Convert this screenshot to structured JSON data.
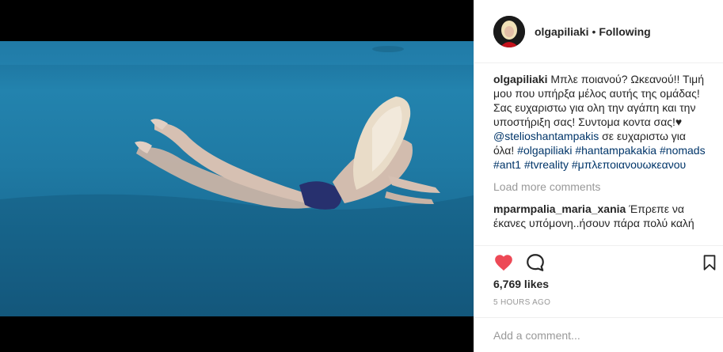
{
  "post": {
    "username": "olgapiliaki",
    "separator": "•",
    "follow_status": "Following"
  },
  "caption": {
    "username": "olgapiliaki",
    "text_part1": " Μπλε ποιανού? Ωκεανού!! Τιμή μου που υπήρξα μέλος αυτής της ομάδας! Σας ευχαριστω για ολη την αγάπη και την υποστήριξη σας! Συντομα κοντα σας!♥ ",
    "mention": "@stelioshantampakis",
    "text_part2": " σε ευχαριστω για όλα! ",
    "hashtags": [
      "#olgapiliaki",
      "#hantampakakia",
      "#nomads",
      "#ant1",
      "#tvreality",
      "#μπλεποιανουωκεανου"
    ]
  },
  "load_more": "Load more comments",
  "comments": [
    {
      "username": "mparmpalia_maria_xania",
      "text": " Έπρεπε να έκανες υπόμονη..ήσουν πάρα πολύ καλή"
    }
  ],
  "likes": "6,769 likes",
  "timestamp": "5 HOURS AGO",
  "comment_box": {
    "placeholder": "Add a comment..."
  },
  "icons": {
    "like": "heart-icon",
    "comment": "comment-icon",
    "save": "bookmark-icon"
  },
  "colors": {
    "like": "#ed4956",
    "link": "#003569",
    "muted": "#999999"
  }
}
